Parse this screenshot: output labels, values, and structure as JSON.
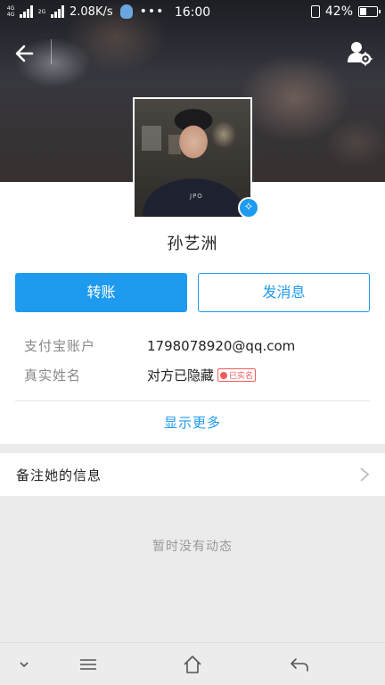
{
  "status_bar": {
    "net_tag_1": "4G 4G",
    "net_tag_2": "2G",
    "speed": "2.08K/s",
    "more": "•••",
    "time": "16:00",
    "battery": "42%",
    "battery_level": 0.42
  },
  "header": {
    "back_icon": "arrow-left-icon",
    "settings_icon": "user-settings-icon"
  },
  "profile": {
    "avatar_shirt_text": "JPO",
    "name": "孙艺洲",
    "verified_icon": "verified-badge-icon"
  },
  "actions": {
    "transfer_label": "转账",
    "message_label": "发消息"
  },
  "info": {
    "alipay_key": "支付宝账户",
    "alipay_value": "1798078920@qq.com",
    "realname_key": "真实姓名",
    "realname_value": "对方已隐藏",
    "realname_badge": "已实名"
  },
  "show_more": "显示更多",
  "note_row": {
    "label": "备注她的信息"
  },
  "empty_state": "暂时没有动态",
  "nav_bar": {
    "icons": [
      "chevron-down-icon",
      "menu-icon",
      "home-icon",
      "back-icon"
    ]
  }
}
